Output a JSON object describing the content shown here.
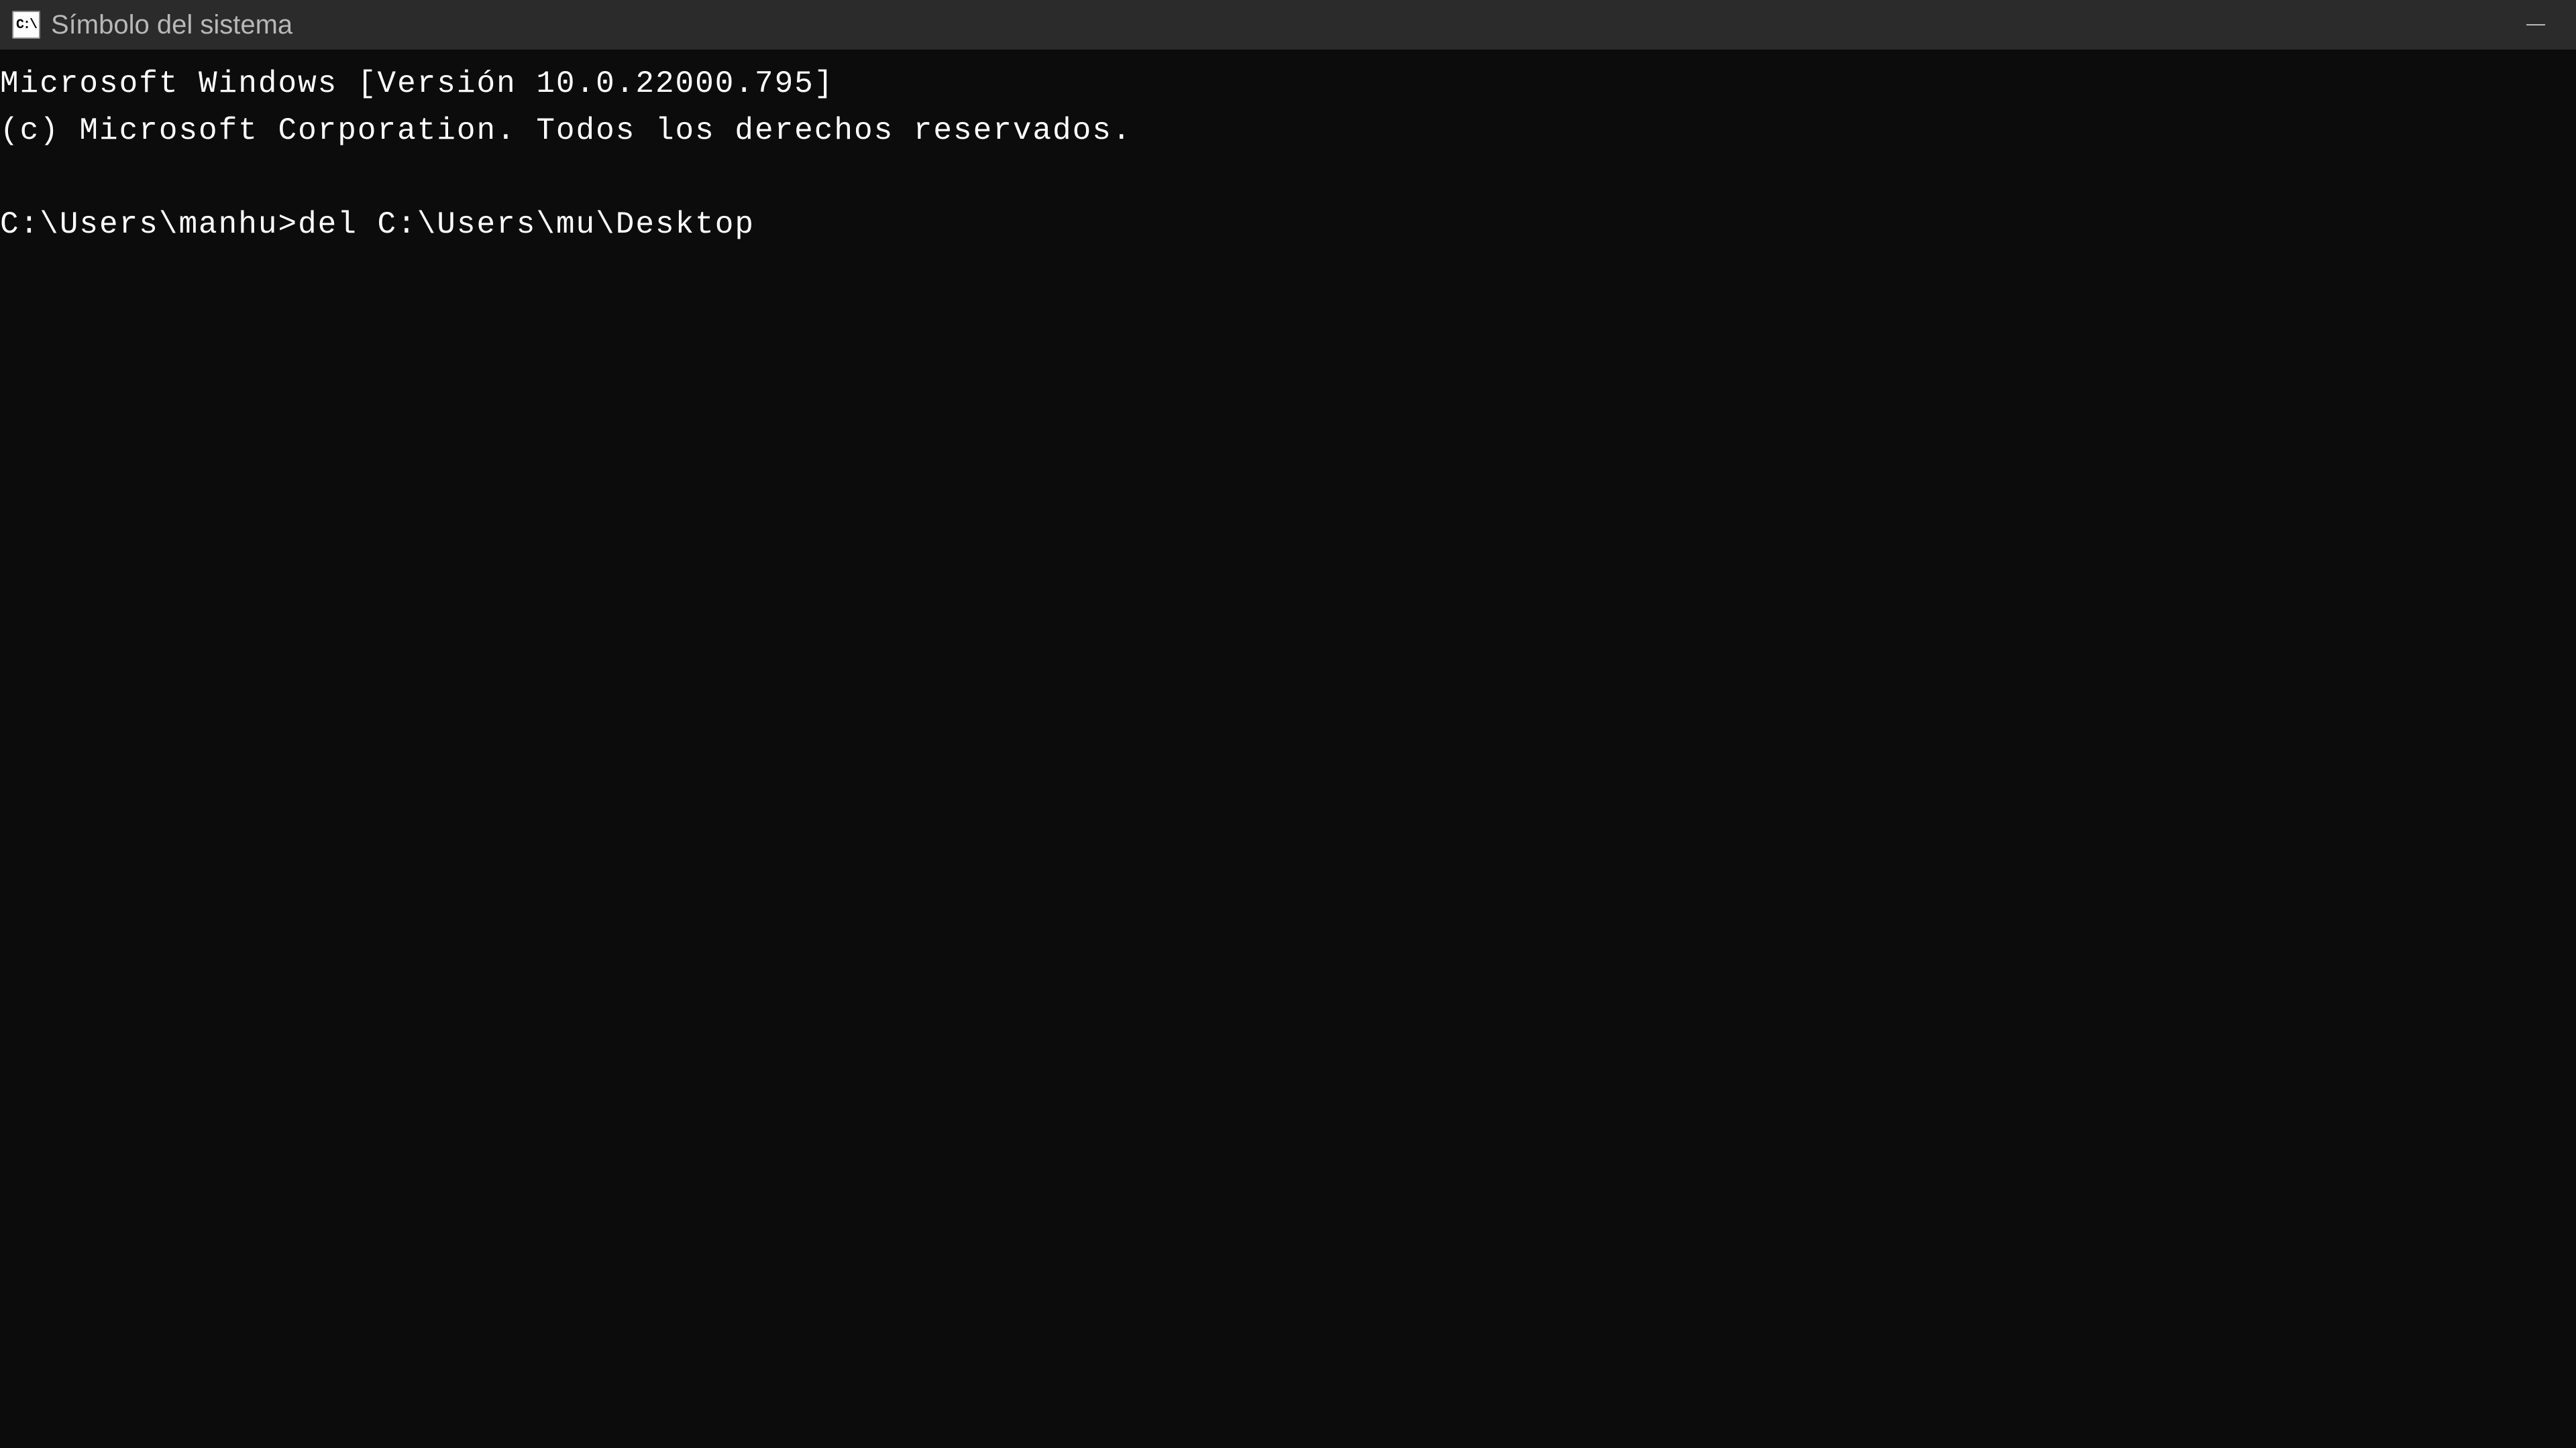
{
  "titlebar": {
    "icon_label": "C:\\",
    "title": "Símbolo del sistema"
  },
  "terminal": {
    "lines": [
      "Microsoft Windows [Versión 10.0.22000.795]",
      "(c) Microsoft Corporation. Todos los derechos reservados."
    ],
    "prompt": "C:\\Users\\manhu>",
    "command": "del C:\\Users\\mu\\Desktop"
  }
}
